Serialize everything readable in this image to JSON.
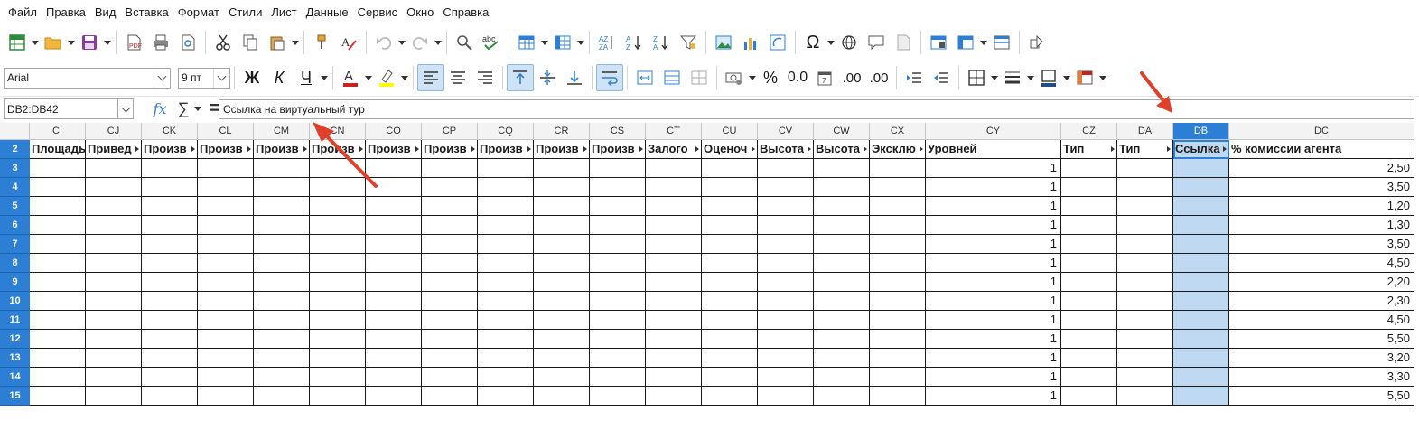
{
  "menu": [
    "Файл",
    "Правка",
    "Вид",
    "Вставка",
    "Формат",
    "Стили",
    "Лист",
    "Данные",
    "Сервис",
    "Окно",
    "Справка"
  ],
  "format_bar": {
    "font_name": "Arial",
    "font_size": "9 пт",
    "bold_glyph": "Ж",
    "italic_glyph": "К",
    "underline_glyph": "Ч",
    "percent_glyph": "%",
    "decimal_glyph": "0.0",
    "add_decimal_glyph": ".00",
    "del_decimal_glyph": ".00"
  },
  "formula_bar": {
    "name_box": "DB2:DB42",
    "fx": "fx",
    "sigma": "∑",
    "equals": "=",
    "content": "Ссылка на виртуальный тур"
  },
  "columns": [
    {
      "letter": "CI",
      "header": "Площадь"
    },
    {
      "letter": "CJ",
      "header": "Привед"
    },
    {
      "letter": "CK",
      "header": "Произв"
    },
    {
      "letter": "CL",
      "header": "Произв"
    },
    {
      "letter": "CM",
      "header": "Произв"
    },
    {
      "letter": "CN",
      "header": "Произв"
    },
    {
      "letter": "CO",
      "header": "Произв"
    },
    {
      "letter": "CP",
      "header": "Произв"
    },
    {
      "letter": "CQ",
      "header": "Произв"
    },
    {
      "letter": "CR",
      "header": "Произв"
    },
    {
      "letter": "CS",
      "header": "Произв"
    },
    {
      "letter": "CT",
      "header": "Залого"
    },
    {
      "letter": "CU",
      "header": "Оценоч"
    },
    {
      "letter": "CV",
      "header": "Высота"
    },
    {
      "letter": "CW",
      "header": "Высота"
    },
    {
      "letter": "CX",
      "header": "Эксклю"
    },
    {
      "letter": "CY",
      "header": "Уровней"
    },
    {
      "letter": "CZ",
      "header": "Тип"
    },
    {
      "letter": "DA",
      "header": "Тип"
    },
    {
      "letter": "DB",
      "header": "Ссылка"
    },
    {
      "letter": "DC",
      "header": "% комиссии агента"
    }
  ],
  "rows": [
    {
      "num": "2"
    },
    {
      "num": "3",
      "cy": "1",
      "dc": "2,50"
    },
    {
      "num": "4",
      "cy": "1",
      "dc": "3,50"
    },
    {
      "num": "5",
      "cy": "1",
      "dc": "1,20"
    },
    {
      "num": "6",
      "cy": "1",
      "dc": "1,30"
    },
    {
      "num": "7",
      "cy": "1",
      "dc": "3,50"
    },
    {
      "num": "8",
      "cy": "1",
      "dc": "4,50"
    },
    {
      "num": "9",
      "cy": "1",
      "dc": "2,20"
    },
    {
      "num": "10",
      "cy": "1",
      "dc": "2,30"
    },
    {
      "num": "11",
      "cy": "1",
      "dc": "4,50"
    },
    {
      "num": "12",
      "cy": "1",
      "dc": "5,50"
    },
    {
      "num": "13",
      "cy": "1",
      "dc": "3,20"
    },
    {
      "num": "14",
      "cy": "1",
      "dc": "3,30"
    },
    {
      "num": "15",
      "cy": "1",
      "dc": "5,50"
    }
  ],
  "selected_column": "DB",
  "colors": {
    "accent": "#2d7fd6",
    "selection": "#bfd9f2",
    "arrow": "#e0402a"
  }
}
